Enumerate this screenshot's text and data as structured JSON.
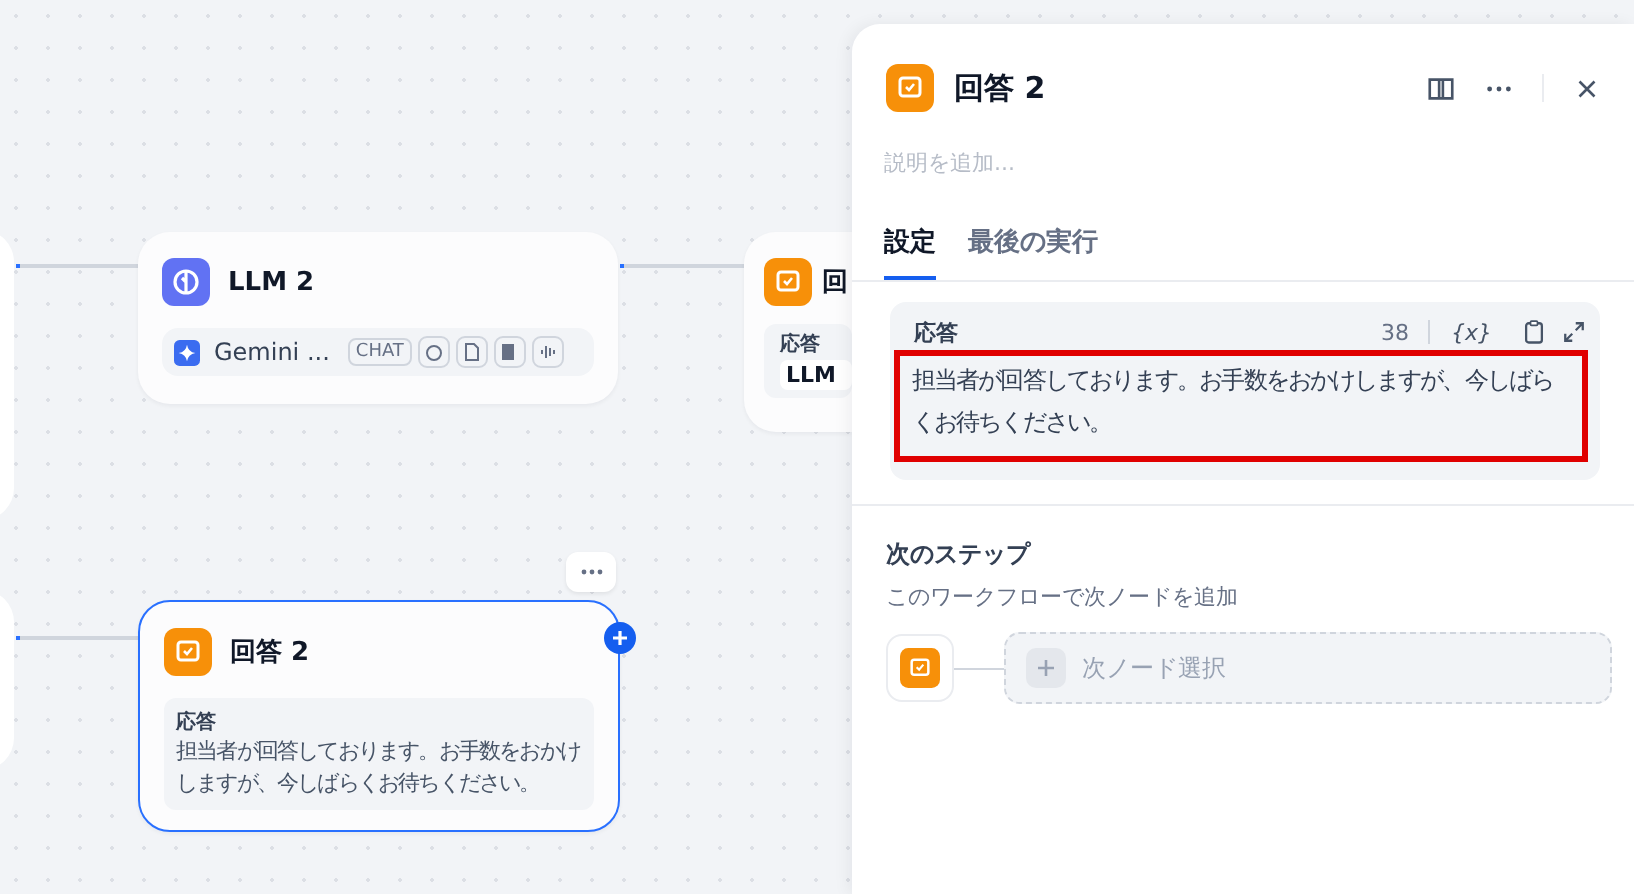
{
  "llm_node": {
    "title": "LLM 2",
    "model": "Gemini ...",
    "mode": "CHAT"
  },
  "partial_answer_node": {
    "title": "回",
    "label": "応答",
    "chip": "LLM"
  },
  "answer_node": {
    "title": "回答 2",
    "label": "応答",
    "text": "担当者が回答しております。お手数をおかけしますが、今しばらくお待ちください。",
    "selected": true
  },
  "panel": {
    "title": "回答 2",
    "description_placeholder": "説明を追加...",
    "tabs": [
      {
        "label": "設定",
        "selected": true
      },
      {
        "label": "最後の実行",
        "selected": false
      }
    ],
    "response": {
      "label": "応答",
      "count": "38",
      "variable_button": "{x}",
      "text": "担当者が回答しております。お手数をおかけしますが、今しばらくお待ちください。"
    },
    "next_step": {
      "title": "次のステップ",
      "subtitle": "このワークフローで次ノードを追加",
      "select_label": "次ノード選択"
    }
  }
}
